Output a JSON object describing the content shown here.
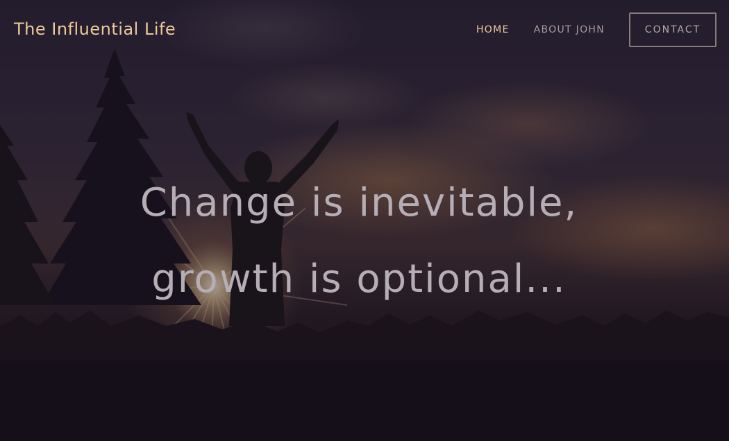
{
  "site": {
    "brand": "The Influential Life"
  },
  "nav": {
    "home": "HOME",
    "about": "ABOUT JOHN",
    "contact": "CONTACT"
  },
  "hero": {
    "line1": "Change is inevitable,",
    "line2": "growth is optional..."
  },
  "colors": {
    "brand": "#f0c89a",
    "nav_active": "#f4caa0",
    "nav_inactive": "#a89a9e",
    "headline": "#b6aeb6",
    "overlay": "#161020"
  }
}
